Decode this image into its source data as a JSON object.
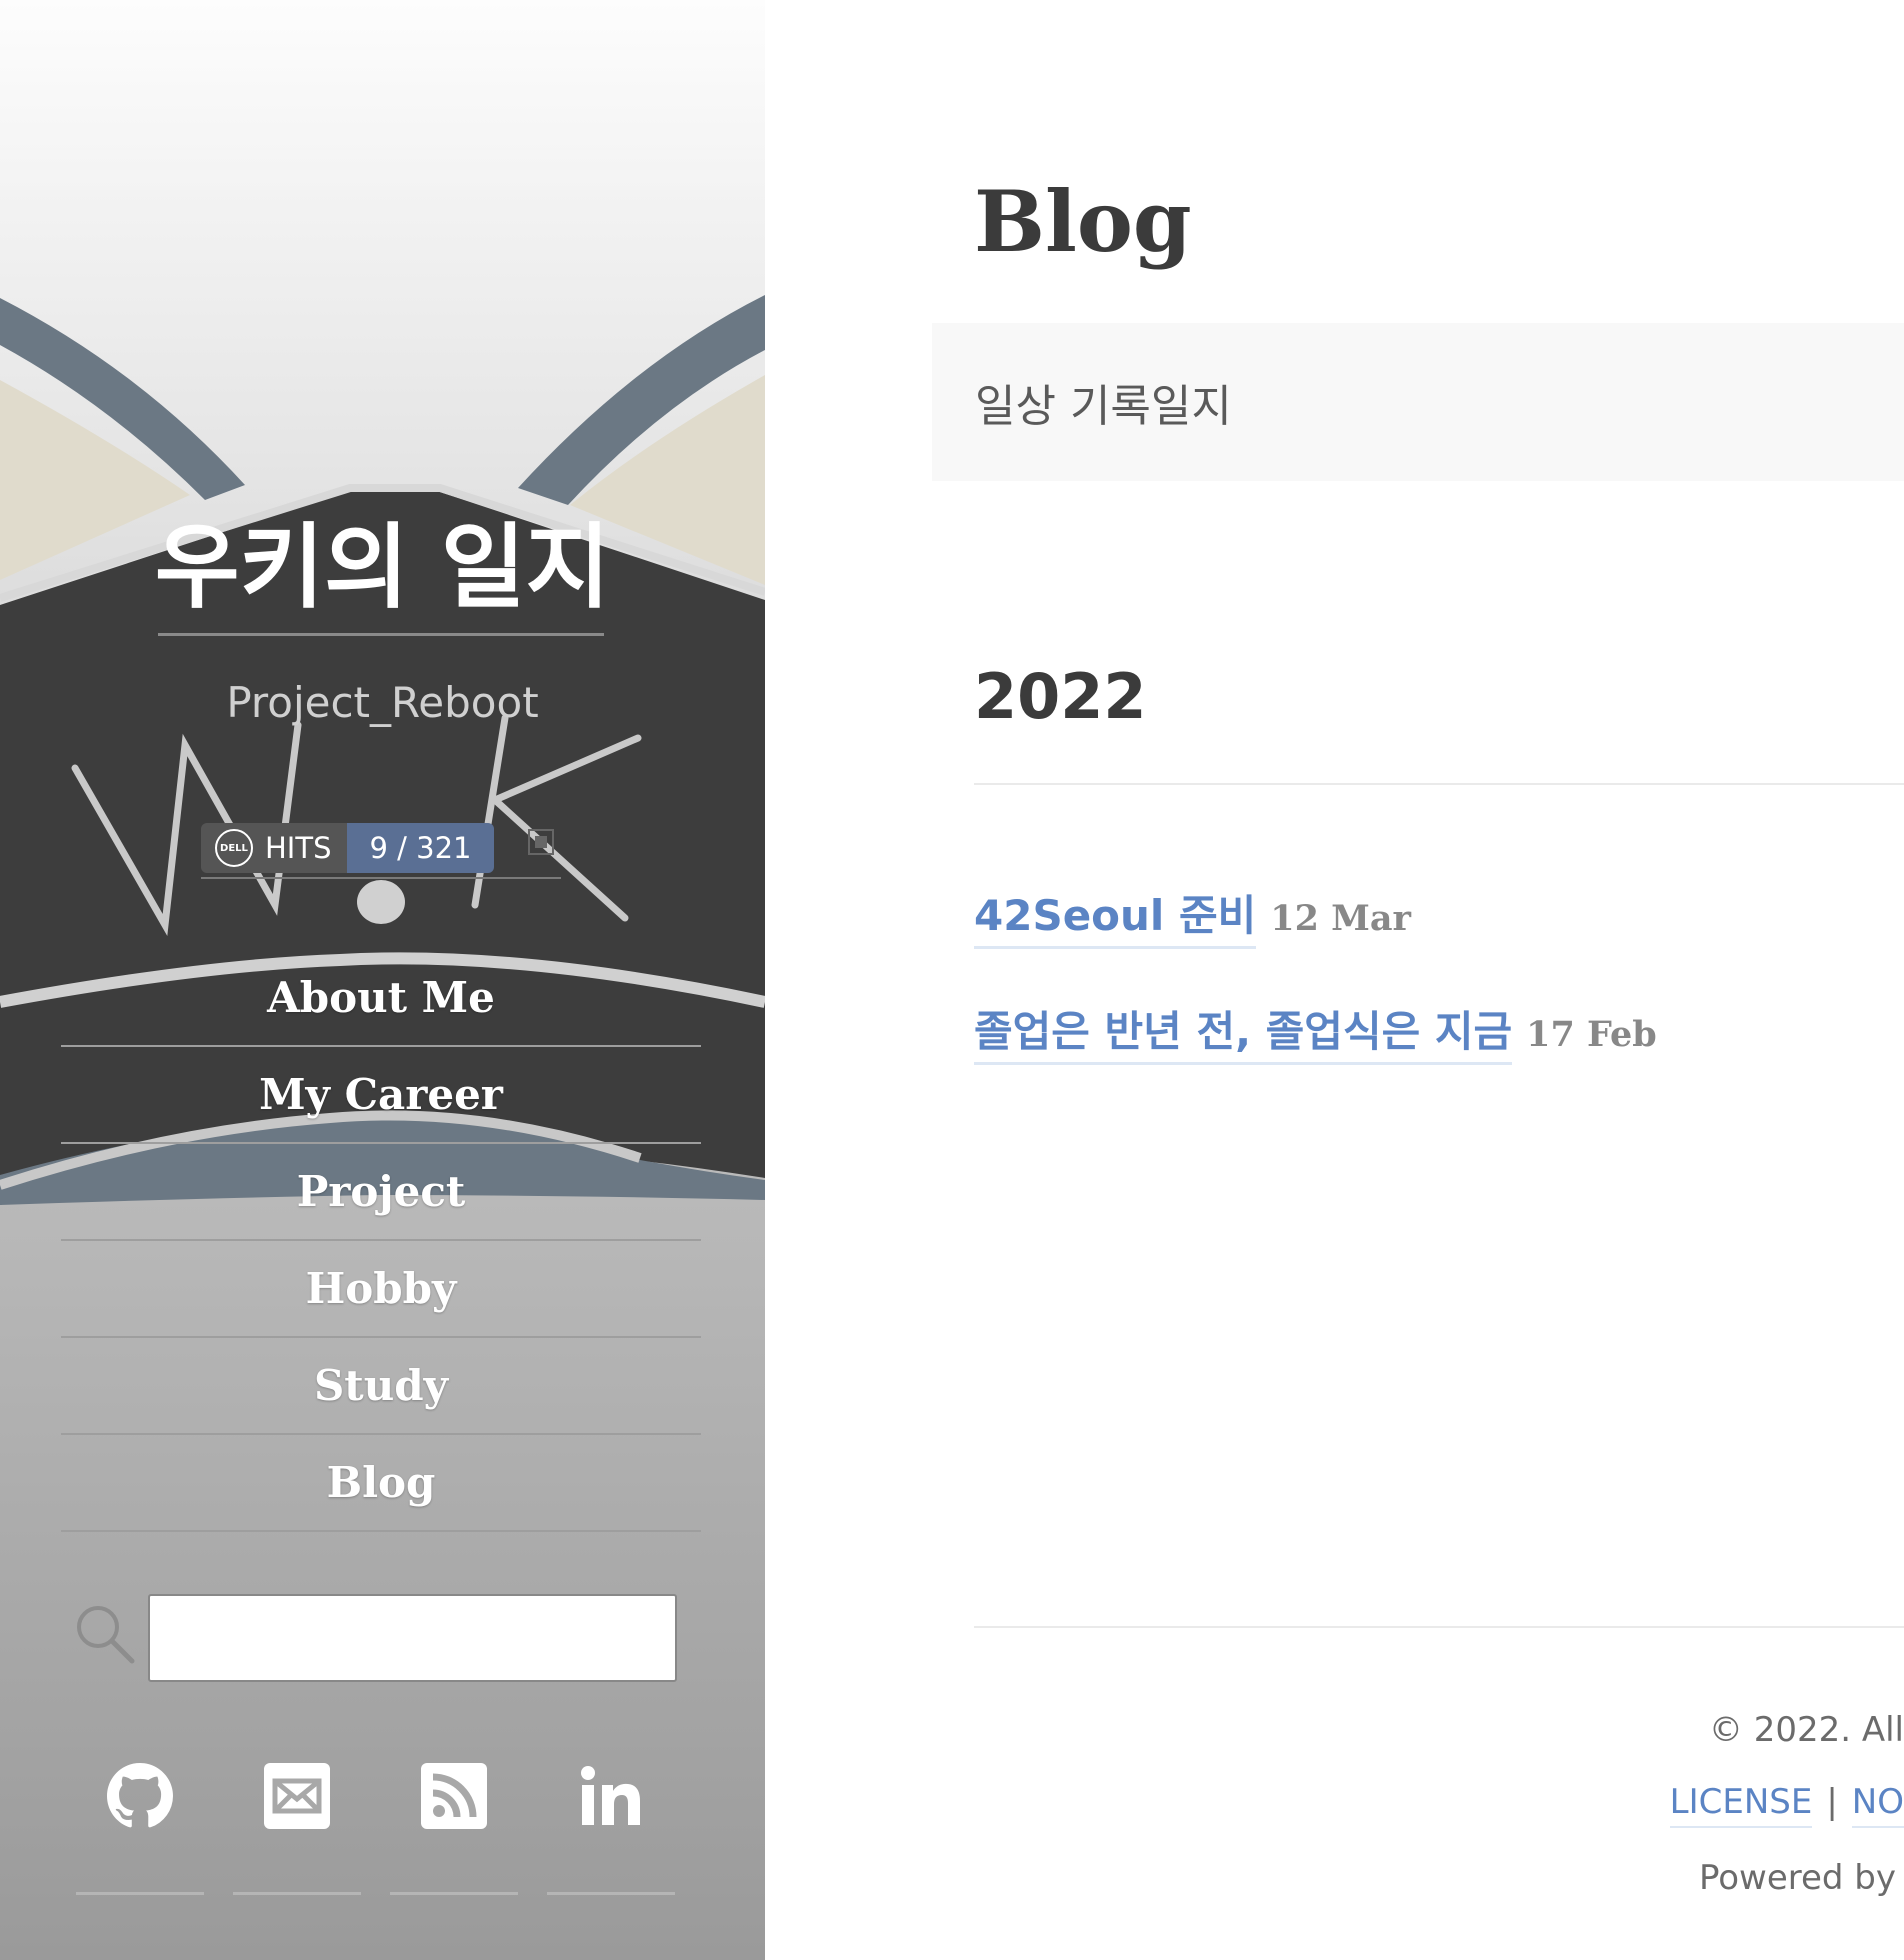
{
  "sidebar": {
    "site_title": "우키의 일지",
    "subtitle": "Project_Reboot",
    "hits": {
      "label": "HITS",
      "value": "9 / 321",
      "logo_text": "DELL"
    },
    "nav_items": [
      {
        "label": "About Me"
      },
      {
        "label": "My Career"
      },
      {
        "label": "Project"
      },
      {
        "label": "Hobby"
      },
      {
        "label": "Study"
      },
      {
        "label": "Blog"
      }
    ],
    "search": {
      "value": "",
      "placeholder": ""
    },
    "social_icons": [
      "github-icon",
      "mail-icon",
      "rss-icon",
      "linkedin-icon"
    ]
  },
  "main": {
    "page_title": "Blog",
    "description": "일상 기록일지",
    "year": "2022",
    "posts": [
      {
        "title": "42Seoul 준비",
        "date": "12 Mar"
      },
      {
        "title": "졸업은 반년 전, 졸업식은 지금",
        "date": "17 Feb"
      }
    ]
  },
  "footer": {
    "copyright": "© 2022. All",
    "links": [
      "LICENSE",
      "NO"
    ],
    "separator": "|",
    "powered_by": "Powered by"
  },
  "colors": {
    "link": "#5b84c4",
    "text_dark": "#3b3b3b",
    "sidebar_dark": "#3d3d3d",
    "sidebar_slate": "#6b7884",
    "badge_value_bg": "#5a6f94"
  }
}
